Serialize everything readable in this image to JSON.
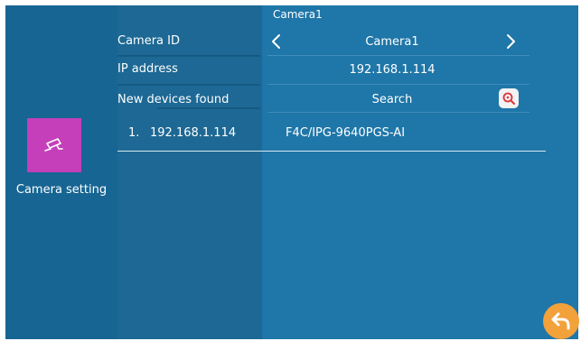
{
  "sidebar": {
    "tile_label": "Camera setting",
    "tile_icon": "cctv-camera-icon"
  },
  "header": {
    "camera_title": "Camera1"
  },
  "labels": {
    "camera_id": "Camera ID",
    "ip_address": "IP address",
    "new_devices": "New devices found"
  },
  "values": {
    "camera_id": "Camera1",
    "ip_address": "192.168.1.114",
    "search": "Search"
  },
  "devices": [
    {
      "index": "1.",
      "ip": "192.168.1.114",
      "model": "F4C/IPG-9640PGS-AI"
    }
  ],
  "colors": {
    "background": "#1b6d9b",
    "tile": "#c43fb9",
    "back_button": "#f3a13a",
    "search_icon": "#e0323a"
  }
}
